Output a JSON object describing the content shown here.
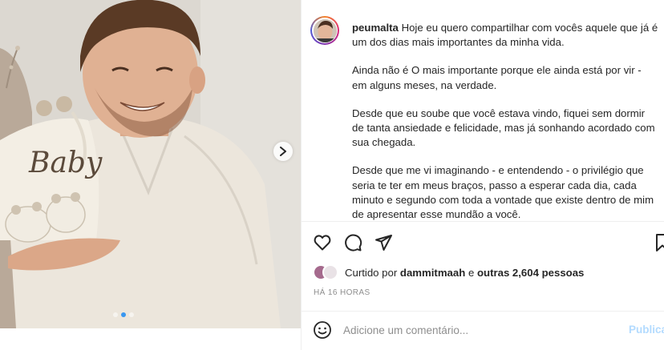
{
  "post": {
    "username": "peumalta",
    "caption_paragraphs": [
      "Hoje eu quero compartilhar com vocês aquele que já é um dos dias mais importantes da minha vida.",
      "Ainda não é O mais importante porque ele ainda está por vir - em alguns meses, na verdade.",
      "Desde que eu soube que você estava vindo, fiquei sem dormir de tanta ansiedade e felicidade, mas já sonhando acordado com sua chegada.",
      "Desde que me vi imaginando - e entendendo - o privilégio que seria te ter em meus braços, passo a esperar cada dia, cada minuto e segundo com toda a vontade que existe dentro de mim de apresentar esse mundão a você."
    ],
    "photo_text": "Baby"
  },
  "actions": {
    "like_icon": "heart-icon",
    "comment_icon": "comment-bubble-icon",
    "share_icon": "paper-plane-icon",
    "save_icon": "bookmark-icon"
  },
  "likes": {
    "prefix": "Curtido por",
    "user": "dammitmaah",
    "conjunction": "e",
    "others": "outras 2,604 pessoas"
  },
  "timestamp": "HÁ 16 HORAS",
  "comment": {
    "placeholder": "Adicione um comentário...",
    "publish_label": "Publicar"
  },
  "carousel": {
    "slide_count": 3,
    "active_index": 1
  },
  "colors": {
    "accent": "#3897f0",
    "publish_disabled": "#b3dbff",
    "text": "#262626",
    "muted": "#8e8e8e",
    "border": "#efefef"
  }
}
